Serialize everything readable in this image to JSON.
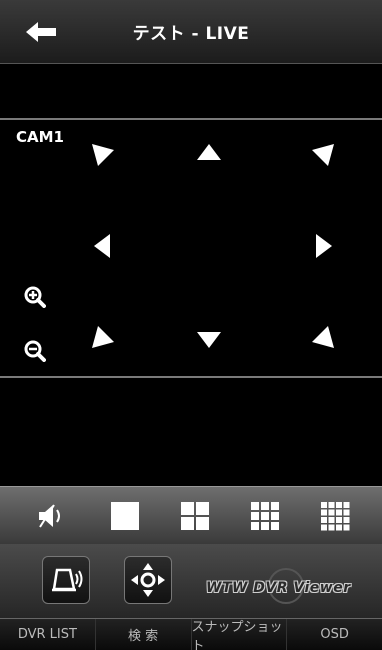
{
  "header": {
    "title": "テスト - LIVE",
    "back_icon": "back-arrow-icon"
  },
  "video": {
    "camera_label": "CAM1"
  },
  "ptz_controls": [
    "up-left",
    "up",
    "up-right",
    "left",
    "right",
    "down-left",
    "down",
    "down-right"
  ],
  "zoom_controls": [
    "zoom-in-icon",
    "zoom-out-icon"
  ],
  "layout_bar": {
    "items": [
      "mute-icon",
      "layout-1-icon",
      "layout-4-icon",
      "layout-9-icon",
      "layout-16-icon"
    ]
  },
  "control_bar": {
    "items": [
      "alarm-icon",
      "ptz-move-icon"
    ],
    "brand": "WTW DVR Viewer"
  },
  "tabs": [
    {
      "label": "DVR LIST"
    },
    {
      "label": "検 索"
    },
    {
      "label": "スナップショット"
    },
    {
      "label": "OSD"
    }
  ]
}
